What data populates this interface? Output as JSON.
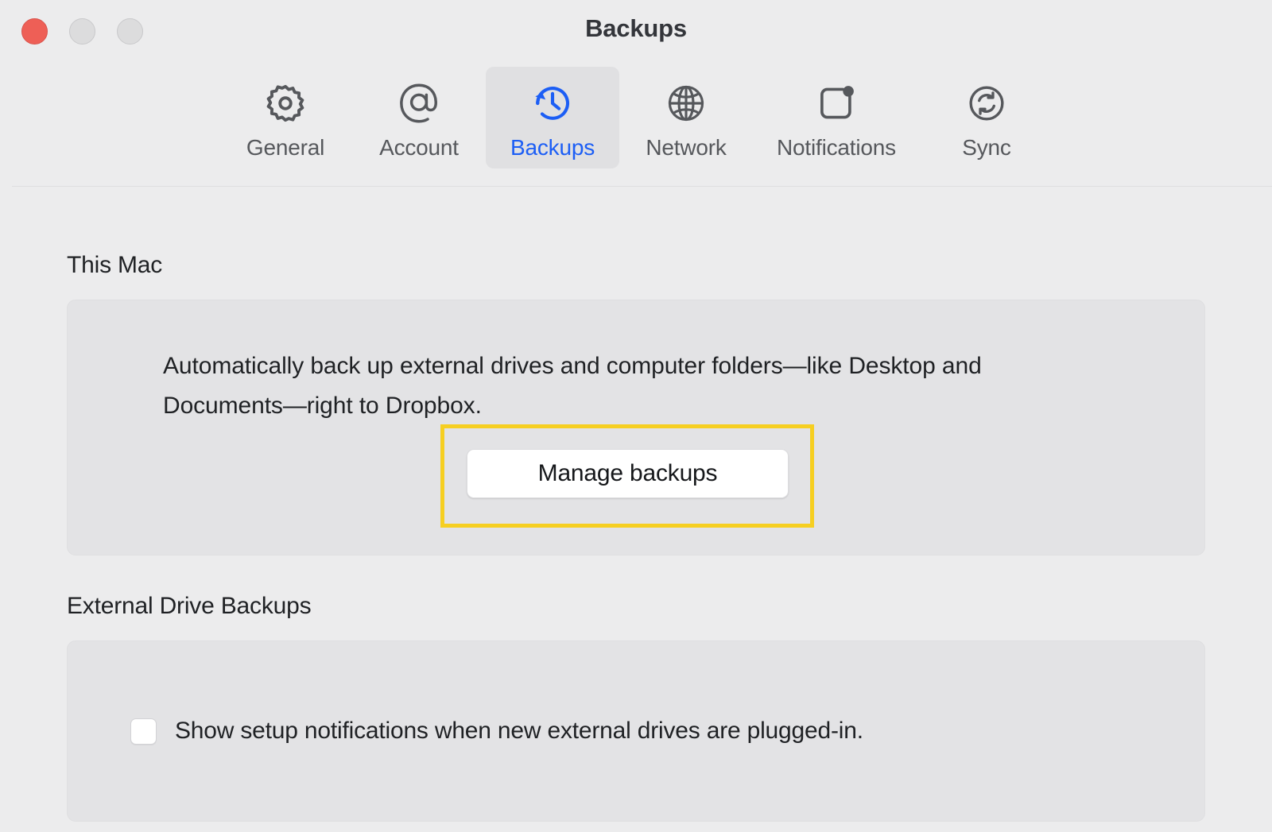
{
  "window": {
    "title": "Backups",
    "traffic_lights": [
      {
        "name": "close",
        "color": "#ee5f56"
      },
      {
        "name": "minimize",
        "color": "#dcdcdd"
      },
      {
        "name": "maximize",
        "color": "#dcdcdd"
      }
    ]
  },
  "toolbar": {
    "tabs": [
      {
        "label": "General",
        "icon": "gear-icon",
        "selected": false
      },
      {
        "label": "Account",
        "icon": "at-sign-icon",
        "selected": false
      },
      {
        "label": "Backups",
        "icon": "clock-rewind-icon",
        "selected": true
      },
      {
        "label": "Network",
        "icon": "globe-icon",
        "selected": false
      },
      {
        "label": "Notifications",
        "icon": "notification-badge-icon",
        "selected": false
      },
      {
        "label": "Sync",
        "icon": "sync-circle-icon",
        "selected": false
      }
    ],
    "selected_tab": "Backups"
  },
  "main": {
    "this_mac": {
      "heading": "This Mac",
      "description": "Automatically back up external drives and computer folders—like Desktop and Documents—right to Dropbox.",
      "manage_button": "Manage backups"
    },
    "external_drive_backups": {
      "heading": "External Drive Backups",
      "checkbox_label": "Show setup notifications when new external drives are plugged-in.",
      "checkbox_checked": false
    }
  },
  "colors": {
    "accent_blue": "#1c5ef5",
    "highlight_yellow": "#f6cf21",
    "window_background": "#ececed",
    "card_background": "#e3e3e5",
    "text_primary": "#1f2124",
    "text_secondary": "#56585c"
  }
}
